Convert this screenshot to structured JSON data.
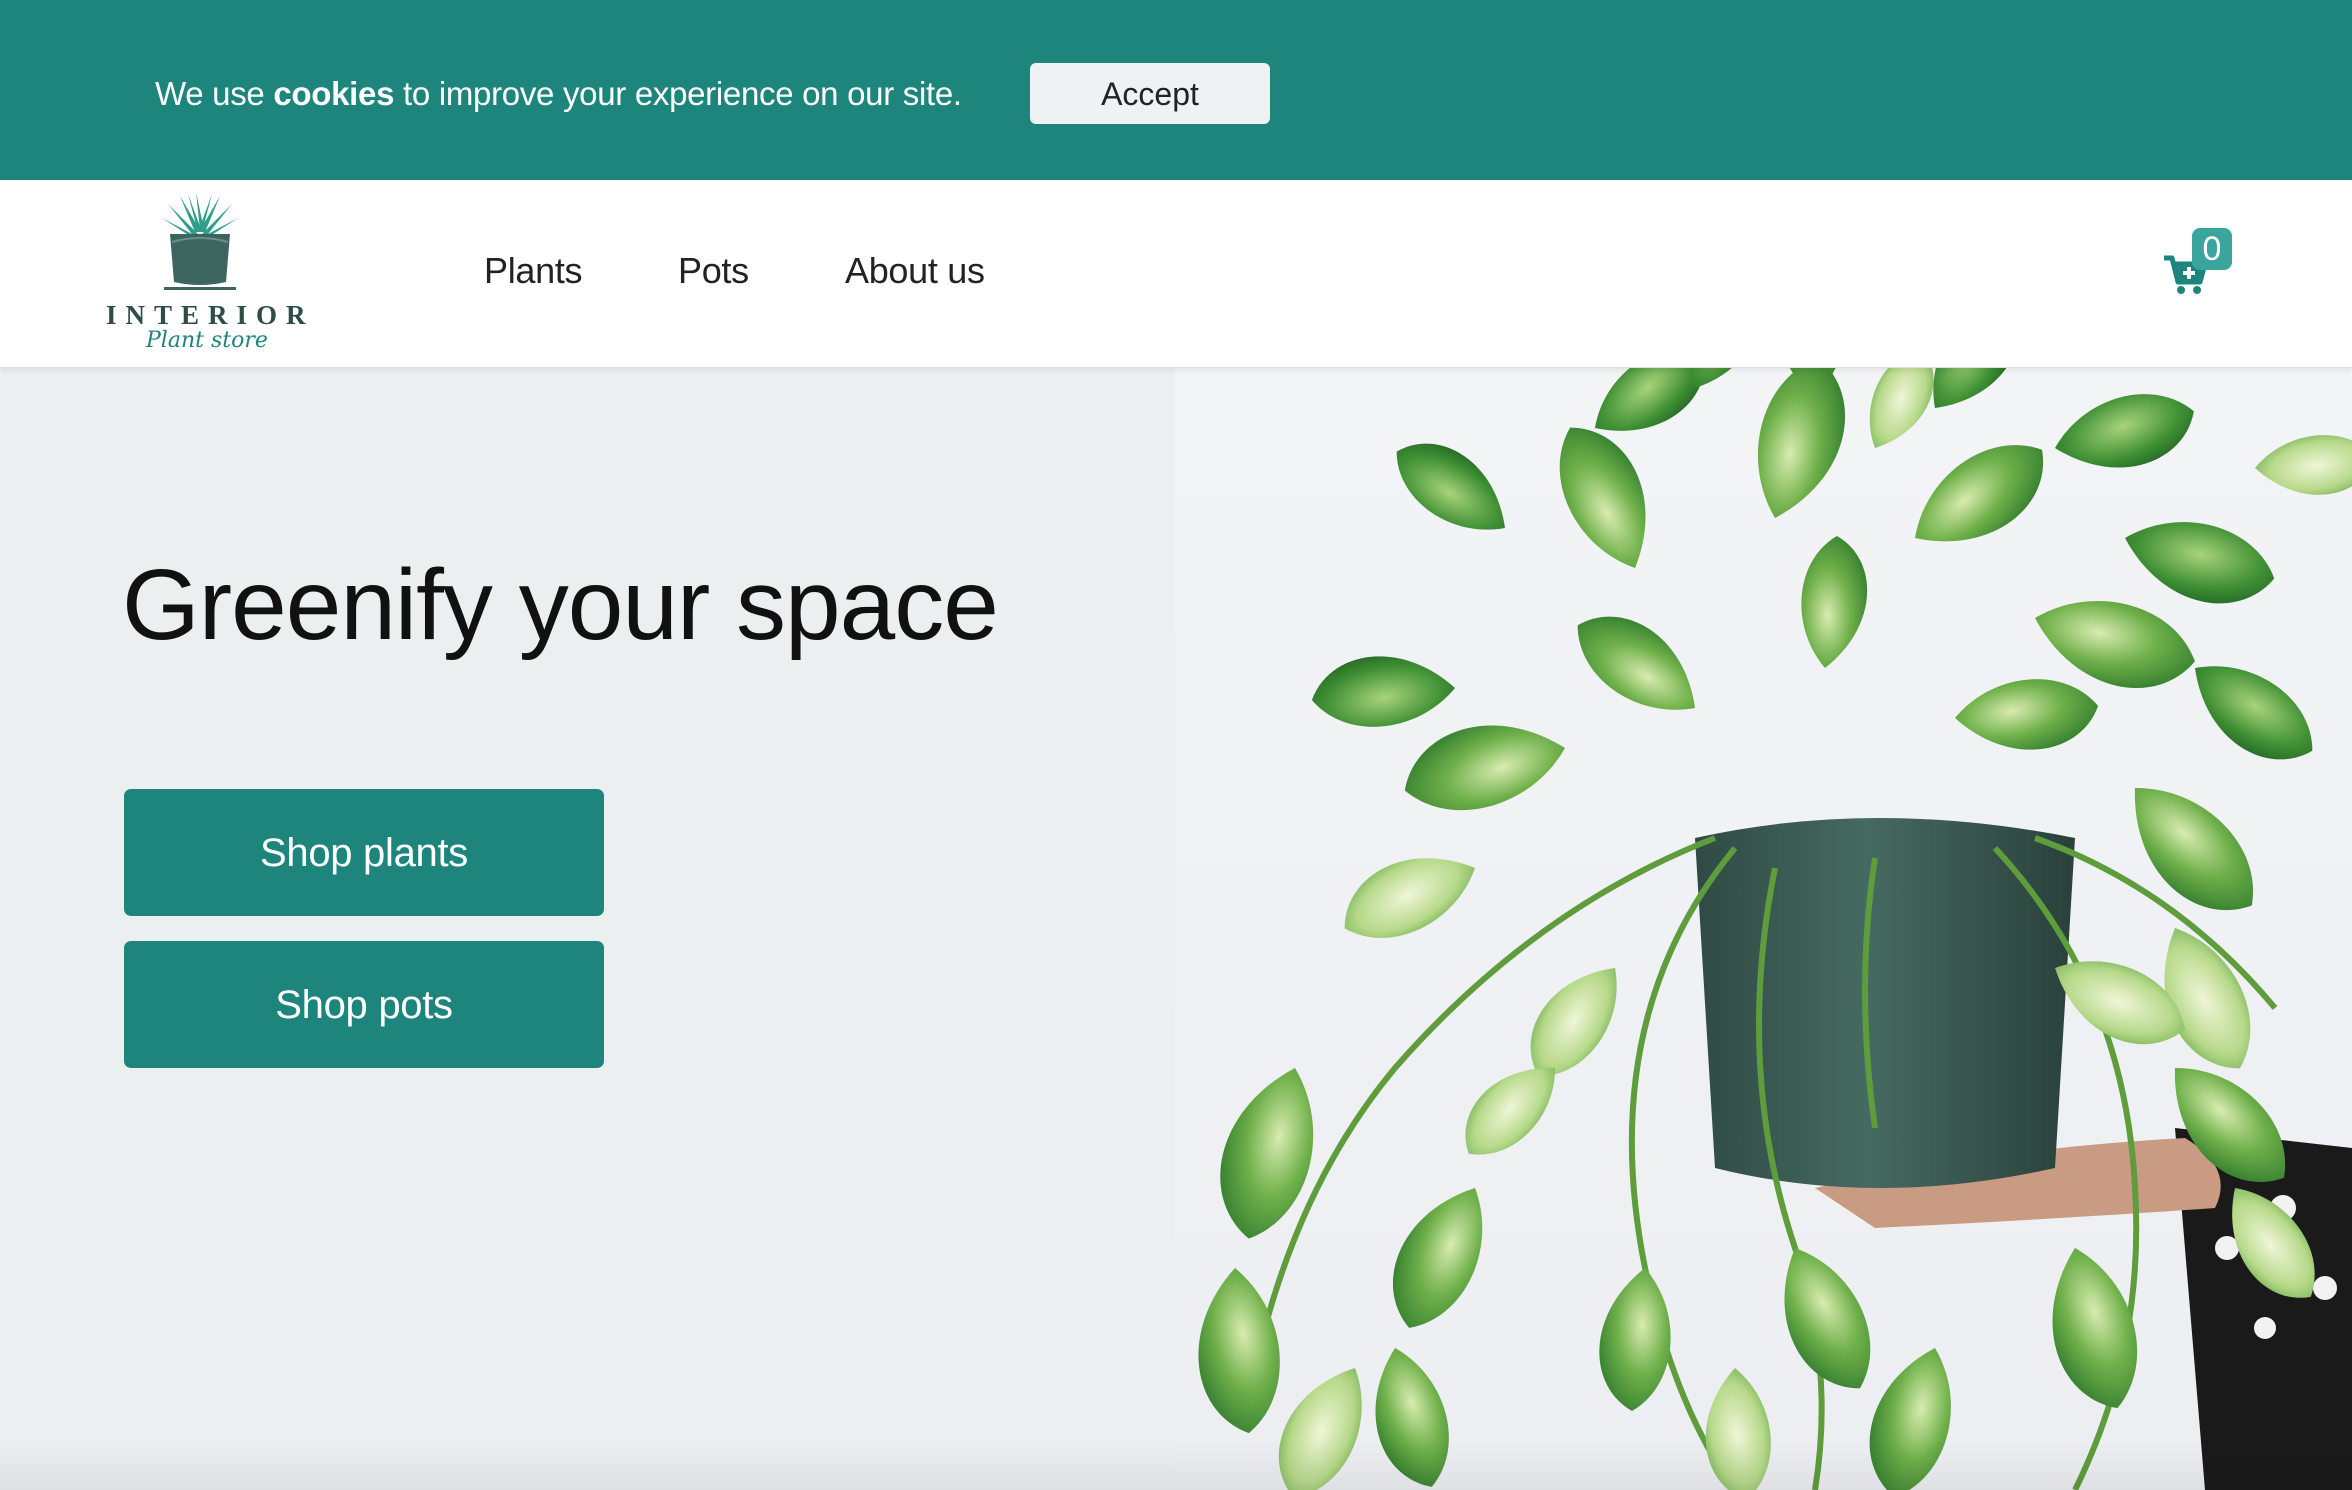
{
  "cookie_banner": {
    "text_before": "We use ",
    "text_bold": "cookies",
    "text_after": " to improve your experience on our site.",
    "accept_label": "Accept"
  },
  "header": {
    "logo": {
      "name": "INTERIOR",
      "tagline": "Plant store"
    },
    "nav": [
      {
        "label": "Plants"
      },
      {
        "label": "Pots"
      },
      {
        "label": "About us"
      }
    ],
    "cart_count": "0"
  },
  "hero": {
    "title": "Greenify your space",
    "buttons": [
      {
        "label": "Shop plants"
      },
      {
        "label": "Shop pots"
      }
    ],
    "image": "potted-pothos-plant-photo"
  },
  "colors": {
    "brand": "#1e857d",
    "badge": "#3aa59c",
    "hero_bg": "#ebefef"
  }
}
